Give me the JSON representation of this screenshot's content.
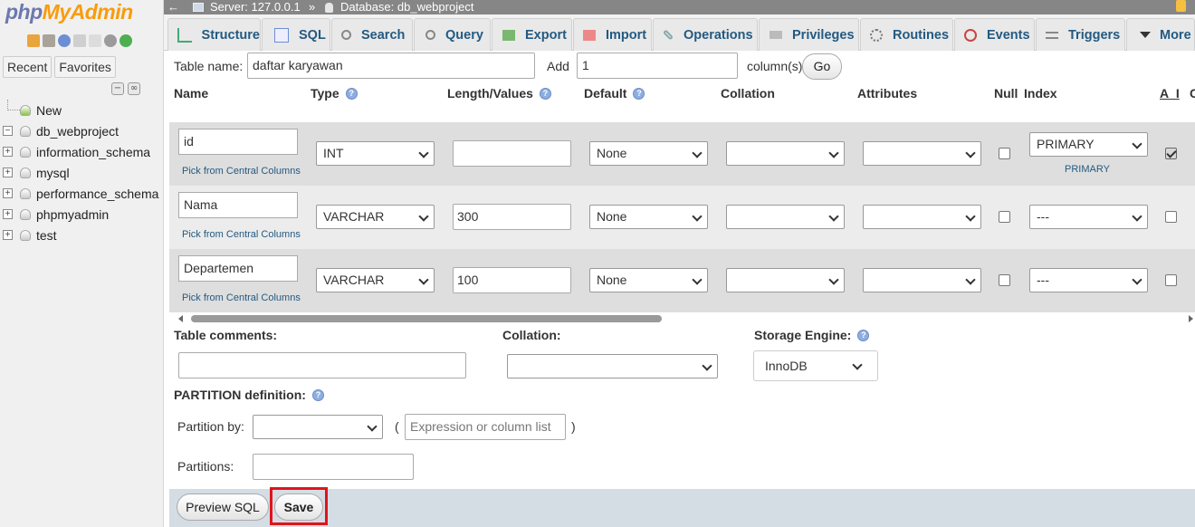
{
  "sidebar": {
    "logo_php": "php",
    "logo_myadmin": "MyAdmin",
    "tabs": [
      "Recent",
      "Favorites"
    ],
    "tree": [
      {
        "label": "New",
        "expandable": false
      },
      {
        "label": "db_webproject",
        "expandable": true,
        "expanded": true
      },
      {
        "label": "information_schema",
        "expandable": true
      },
      {
        "label": "mysql",
        "expandable": true
      },
      {
        "label": "performance_schema",
        "expandable": true
      },
      {
        "label": "phpmyadmin",
        "expandable": true
      },
      {
        "label": "test",
        "expandable": true
      }
    ]
  },
  "breadcrumb": {
    "server": "Server: 127.0.0.1",
    "separator": "»",
    "database": "Database: db_webproject"
  },
  "menu": {
    "tabs": [
      {
        "label": "Structure",
        "icon": "structure-icon"
      },
      {
        "label": "SQL",
        "icon": "sql-icon"
      },
      {
        "label": "Search",
        "icon": "search-icon"
      },
      {
        "label": "Query",
        "icon": "query-icon"
      },
      {
        "label": "Export",
        "icon": "export-icon"
      },
      {
        "label": "Import",
        "icon": "import-icon"
      },
      {
        "label": "Operations",
        "icon": "wrench-icon"
      },
      {
        "label": "Privileges",
        "icon": "privileges-icon"
      },
      {
        "label": "Routines",
        "icon": "routines-icon"
      },
      {
        "label": "Events",
        "icon": "clock-icon"
      },
      {
        "label": "Triggers",
        "icon": "triggers-icon"
      },
      {
        "label": "More",
        "icon": "caret-down-icon"
      }
    ]
  },
  "form": {
    "table_name_label": "Table name:",
    "table_name_value": "daftar karyawan",
    "add_label": "Add",
    "add_value": "1",
    "columns_suffix": "column(s)",
    "go_label": "Go"
  },
  "columns_header": {
    "name": "Name",
    "type": "Type",
    "length": "Length/Values",
    "default": "Default",
    "collation": "Collation",
    "attributes": "Attributes",
    "null": "Null",
    "index": "Index",
    "ai": "A_I",
    "comments_partial": "C"
  },
  "rows": [
    {
      "name": "id",
      "type": "INT",
      "length": "",
      "default": "None",
      "collation": "",
      "attributes": "",
      "null": false,
      "index": "PRIMARY",
      "index_note": "PRIMARY",
      "ai": true,
      "pick": "Pick from Central Columns"
    },
    {
      "name": "Nama",
      "type": "VARCHAR",
      "length": "300",
      "default": "None",
      "collation": "",
      "attributes": "",
      "null": false,
      "index": "---",
      "ai": false,
      "pick": "Pick from Central Columns"
    },
    {
      "name": "Departemen",
      "type": "VARCHAR",
      "length": "100",
      "default": "None",
      "collation": "",
      "attributes": "",
      "null": false,
      "index": "---",
      "ai": false,
      "pick": "Pick from Central Columns"
    }
  ],
  "table_options": {
    "comments_label": "Table comments:",
    "collation_label": "Collation:",
    "storage_label": "Storage Engine:",
    "storage_value": "InnoDB"
  },
  "partition": {
    "heading": "PARTITION definition:",
    "by_label": "Partition by:",
    "expr_placeholder": "Expression or column list",
    "paren_open": "(",
    "paren_close": ")",
    "partitions_label": "Partitions:"
  },
  "actions": {
    "preview_sql": "Preview SQL",
    "save": "Save"
  },
  "colors": {
    "link": "#235a81",
    "topbar": "#868686",
    "highlight": "#e0141b"
  }
}
